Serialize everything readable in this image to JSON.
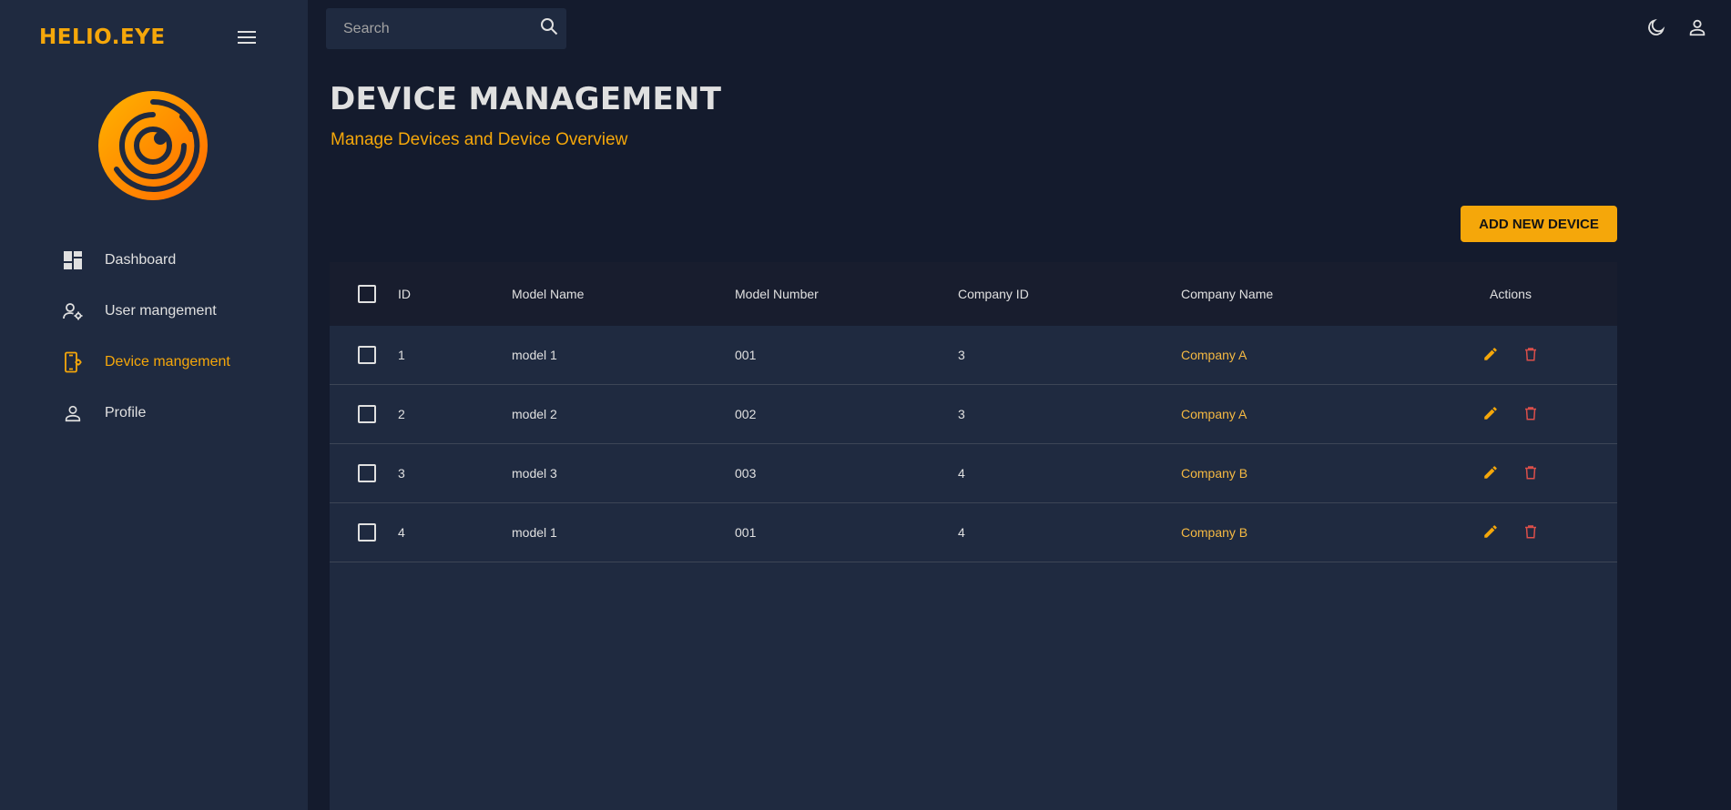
{
  "brand": {
    "name": "HELIO.EYE",
    "accent": "#f5a70a"
  },
  "sidebar": {
    "items": [
      {
        "label": "Dashboard",
        "icon": "dashboard-icon"
      },
      {
        "label": "User mangement",
        "icon": "user-settings-icon"
      },
      {
        "label": "Device mangement",
        "icon": "device-settings-icon",
        "active": true
      },
      {
        "label": "Profile",
        "icon": "person-icon"
      }
    ]
  },
  "search": {
    "placeholder": "Search"
  },
  "page": {
    "title": "DEVICE MANAGEMENT",
    "subtitle": "Manage Devices and Device Overview",
    "add_button": "ADD NEW DEVICE"
  },
  "table": {
    "columns": [
      "ID",
      "Model Name",
      "Model Number",
      "Company ID",
      "Company Name",
      "Actions"
    ],
    "rows": [
      {
        "id": "1",
        "model_name": "model 1",
        "model_number": "001",
        "company_id": "3",
        "company_name": "Company A"
      },
      {
        "id": "2",
        "model_name": "model 2",
        "model_number": "002",
        "company_id": "3",
        "company_name": "Company A"
      },
      {
        "id": "3",
        "model_name": "model 3",
        "model_number": "003",
        "company_id": "4",
        "company_name": "Company B"
      },
      {
        "id": "4",
        "model_name": "model 1",
        "model_number": "001",
        "company_id": "4",
        "company_name": "Company B"
      }
    ]
  },
  "colors": {
    "background": "#141b2d",
    "panel": "#1f2a40",
    "accent": "#f5a70a",
    "delete": "#db4f4a"
  }
}
